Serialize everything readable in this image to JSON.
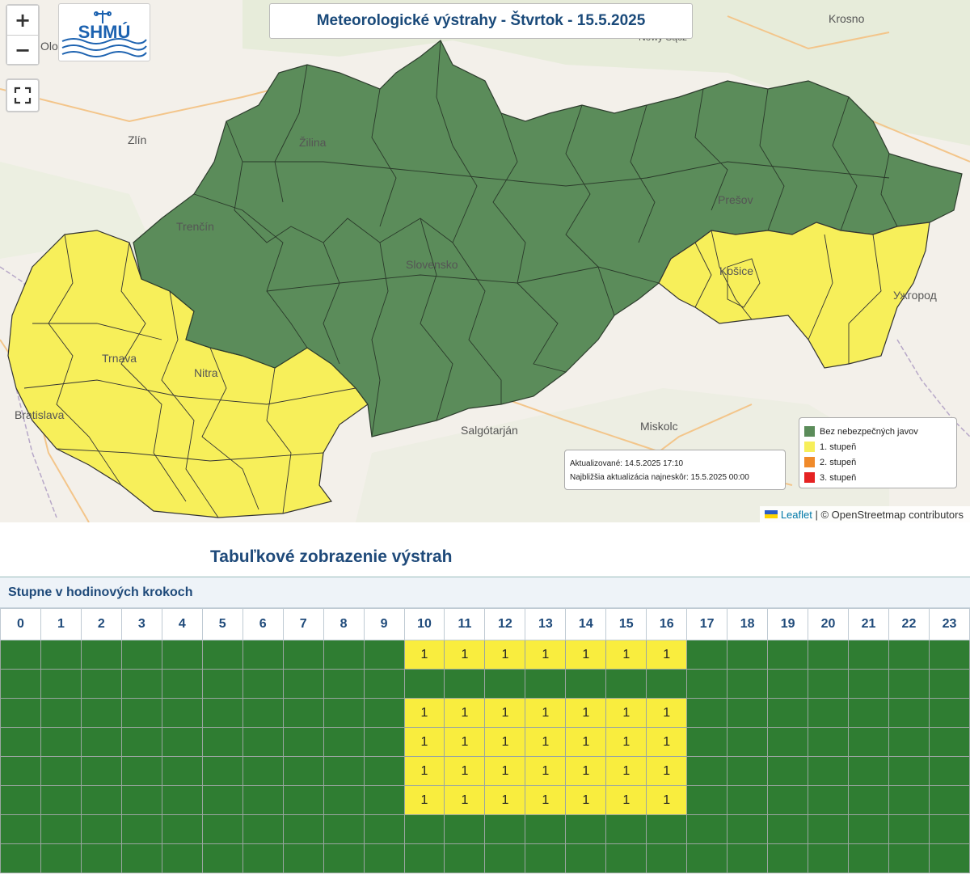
{
  "map": {
    "title": "Meteorologické výstrahy - Štvrtok - 15.5.2025",
    "logo_text": "SHMÚ",
    "zoom_in": "+",
    "zoom_out": "−",
    "fullscreen_icon": "fullscreen-icon",
    "places": {
      "olomouc": "Olo",
      "zlin": "Zlín",
      "zilina": "Žilina",
      "trencin": "Trenčín",
      "trnava": "Trnava",
      "nitra": "Nitra",
      "bratislava": "Bratislava",
      "slovensko": "Slovensko",
      "presov": "Prešov",
      "kosice": "Košice",
      "uzhhorod": "Ужгород",
      "salgotarjan": "Salgótarján",
      "miskolc": "Miskolc",
      "krosno": "Krosno",
      "nowy_sacz": "Nowy Sącz"
    },
    "update": {
      "updated": "Aktualizované: 14.5.2025 17:10",
      "next": "Najbližšia aktualizácia najneskôr: 15.5.2025 00:00"
    },
    "legend": [
      {
        "label": "Bez nebezpečných javov",
        "color": "#5b8c5a"
      },
      {
        "label": "1. stupeň",
        "color": "#f7ef5a"
      },
      {
        "label": "2. stupeň",
        "color": "#f08a2a"
      },
      {
        "label": "3. stupeň",
        "color": "#e52222"
      }
    ],
    "attribution": {
      "leaflet": "Leaflet",
      "rest": "| © OpenStreetmap contributors"
    }
  },
  "table": {
    "section_title": "Tabuľkové zobrazenie výstrah",
    "header": "Stupne v hodinových krokoch",
    "hours": [
      "0",
      "1",
      "2",
      "3",
      "4",
      "5",
      "6",
      "7",
      "8",
      "9",
      "10",
      "11",
      "12",
      "13",
      "14",
      "15",
      "16",
      "17",
      "18",
      "19",
      "20",
      "21",
      "22",
      "23"
    ],
    "rows": [
      [
        0,
        0,
        0,
        0,
        0,
        0,
        0,
        0,
        0,
        0,
        1,
        1,
        1,
        1,
        1,
        1,
        1,
        0,
        0,
        0,
        0,
        0,
        0,
        0
      ],
      [
        0,
        0,
        0,
        0,
        0,
        0,
        0,
        0,
        0,
        0,
        0,
        0,
        0,
        0,
        0,
        0,
        0,
        0,
        0,
        0,
        0,
        0,
        0,
        0
      ],
      [
        0,
        0,
        0,
        0,
        0,
        0,
        0,
        0,
        0,
        0,
        1,
        1,
        1,
        1,
        1,
        1,
        1,
        0,
        0,
        0,
        0,
        0,
        0,
        0
      ],
      [
        0,
        0,
        0,
        0,
        0,
        0,
        0,
        0,
        0,
        0,
        1,
        1,
        1,
        1,
        1,
        1,
        1,
        0,
        0,
        0,
        0,
        0,
        0,
        0
      ],
      [
        0,
        0,
        0,
        0,
        0,
        0,
        0,
        0,
        0,
        0,
        1,
        1,
        1,
        1,
        1,
        1,
        1,
        0,
        0,
        0,
        0,
        0,
        0,
        0
      ],
      [
        0,
        0,
        0,
        0,
        0,
        0,
        0,
        0,
        0,
        0,
        1,
        1,
        1,
        1,
        1,
        1,
        1,
        0,
        0,
        0,
        0,
        0,
        0,
        0
      ],
      [
        0,
        0,
        0,
        0,
        0,
        0,
        0,
        0,
        0,
        0,
        0,
        0,
        0,
        0,
        0,
        0,
        0,
        0,
        0,
        0,
        0,
        0,
        0,
        0
      ],
      [
        0,
        0,
        0,
        0,
        0,
        0,
        0,
        0,
        0,
        0,
        0,
        0,
        0,
        0,
        0,
        0,
        0,
        0,
        0,
        0,
        0,
        0,
        0,
        0
      ]
    ],
    "colors": {
      "level0": "#2f7d32",
      "level1": "#f9ed3e"
    }
  }
}
